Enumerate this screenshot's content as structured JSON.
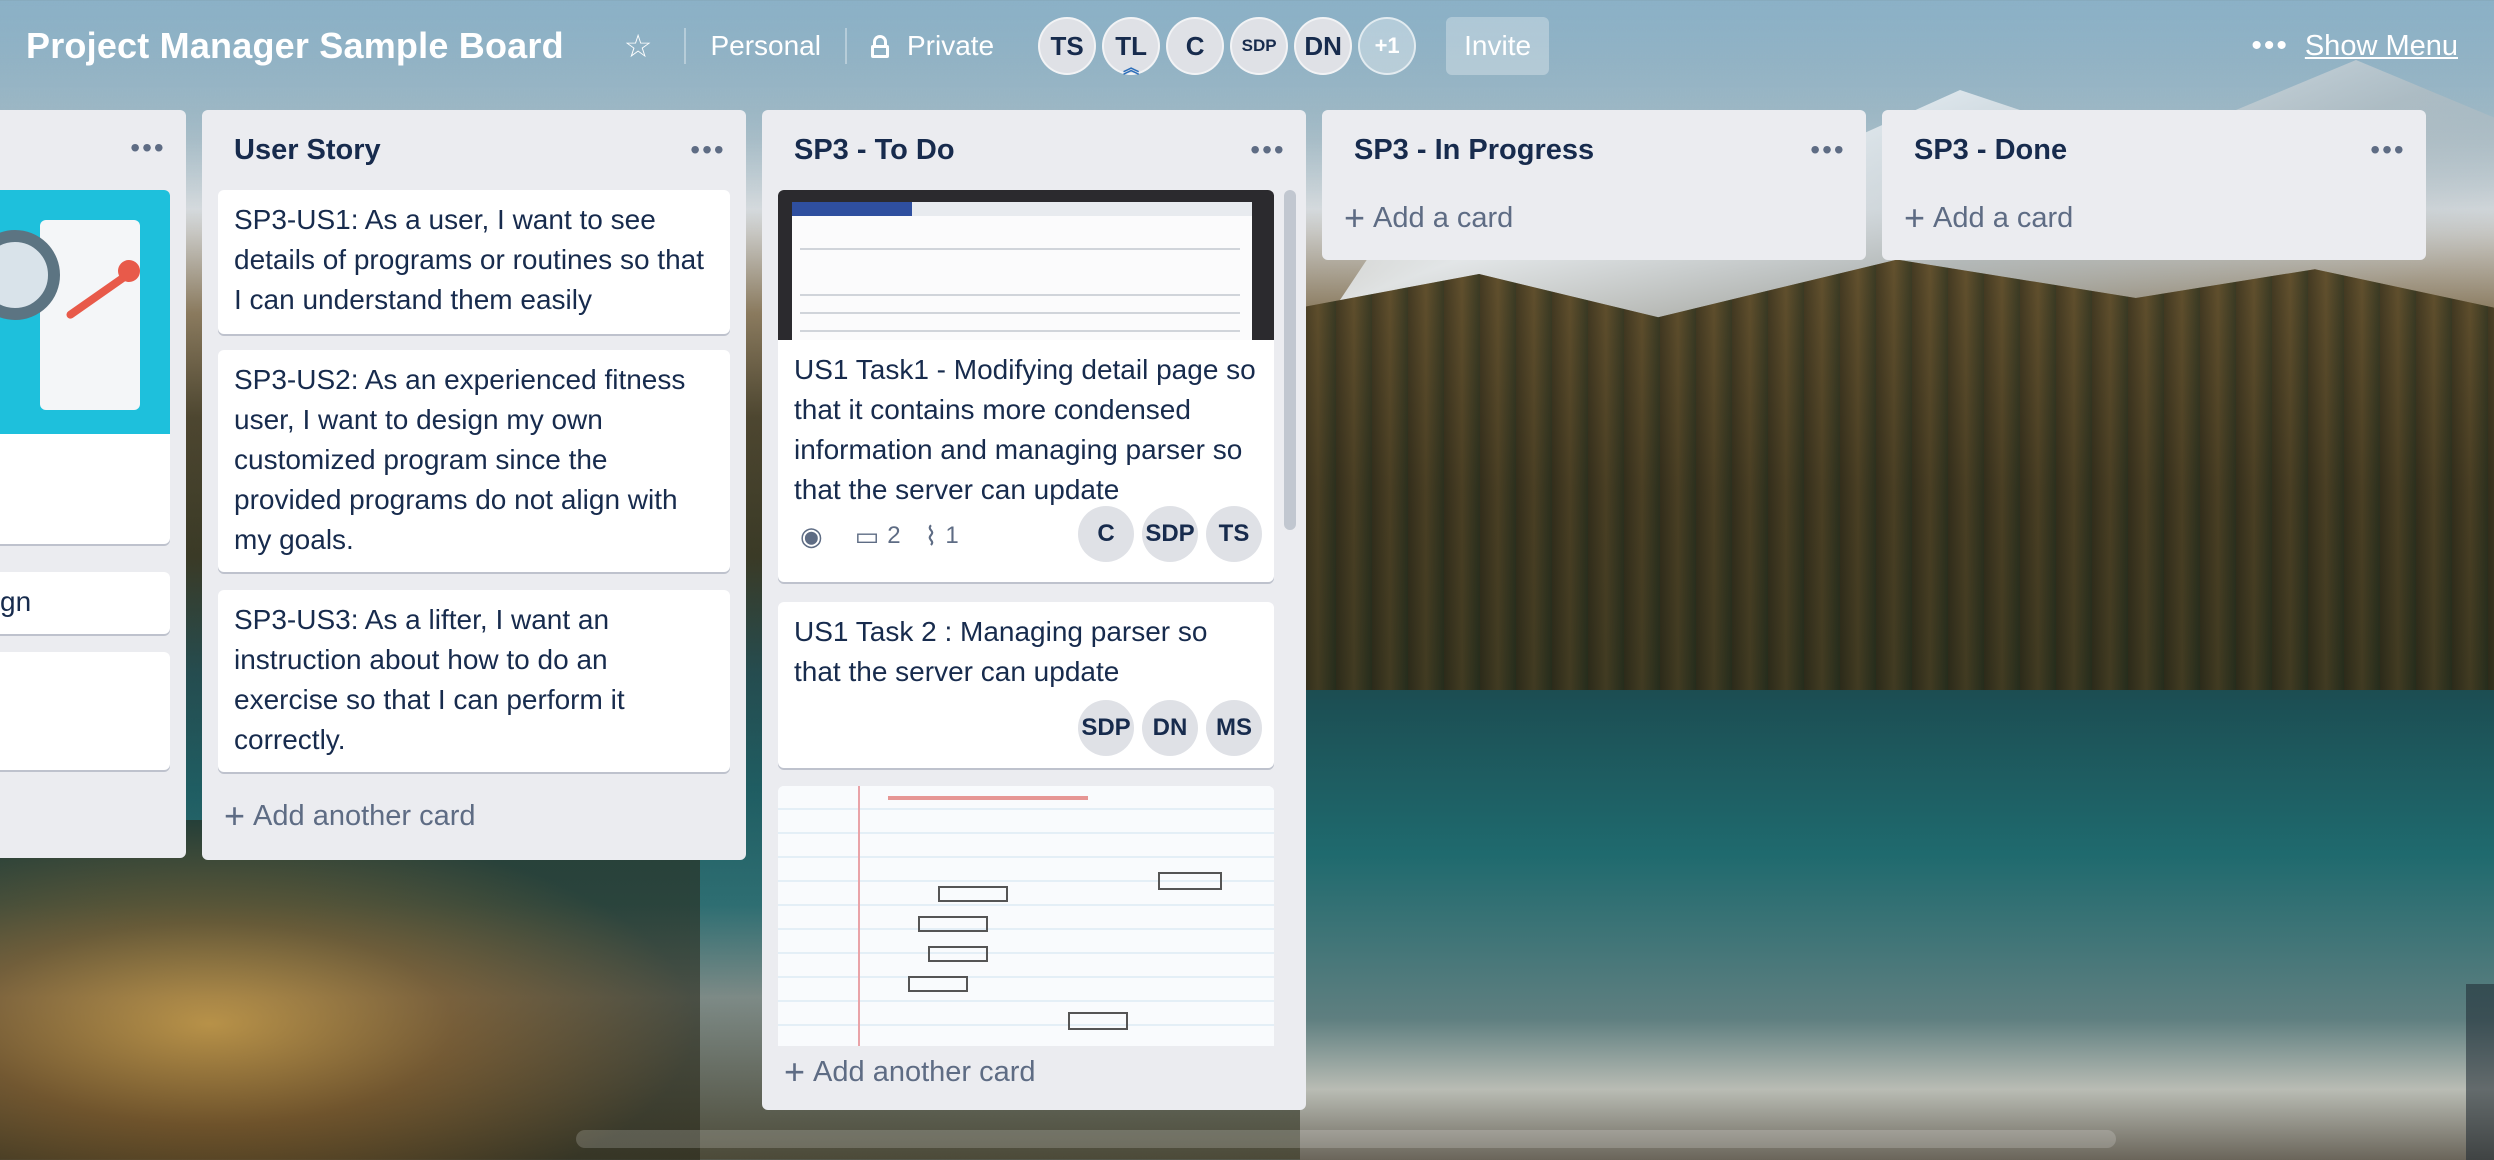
{
  "header": {
    "title": "Project Manager Sample Board",
    "workspace": "Personal",
    "visibility": "Private",
    "members": [
      "TS",
      "TL",
      "C",
      "SDP",
      "DN"
    ],
    "more_members": "+1",
    "invite": "Invite",
    "show_menu": "Show Menu"
  },
  "lists": {
    "prev": {
      "partial_texts": [
        "gn"
      ]
    },
    "user_story": {
      "title": "User Story",
      "cards": [
        "SP3-US1: As a user, I want to see details of programs or routines so that I can understand them easily",
        "SP3-US2: As an experienced fitness user, I want to design my own customized program since the provided programs do not align with my goals.",
        "SP3-US3: As a lifter, I want an instruction about how to do an exercise so that I can perform it correctly."
      ],
      "add": "Add another card"
    },
    "todo": {
      "title": "SP3 - To Do",
      "card1": {
        "text": "US1 Task1 - Modifying detail page so that it contains more condensed information and managing parser so that the server can update",
        "comments": "2",
        "attachments": "1",
        "members": [
          "C",
          "SDP",
          "TS"
        ]
      },
      "card2": {
        "text": "US1 Task 2 : Managing parser so that the server can update",
        "members": [
          "SDP",
          "DN",
          "MS"
        ]
      },
      "add": "Add another card"
    },
    "in_progress": {
      "title": "SP3 - In Progress",
      "add": "Add a card"
    },
    "done": {
      "title": "SP3 - Done",
      "add": "Add a card"
    }
  },
  "icons": {
    "star": "star-icon",
    "lock": "lock-icon",
    "menu": "more-horizontal-icon",
    "watch": "eye-icon",
    "comment": "comment-icon",
    "attachment": "paperclip-icon"
  },
  "colors": {
    "list_bg": "#ebecf0",
    "card_bg": "#ffffff",
    "text": "#172b4d",
    "muted": "#5e6c84"
  }
}
